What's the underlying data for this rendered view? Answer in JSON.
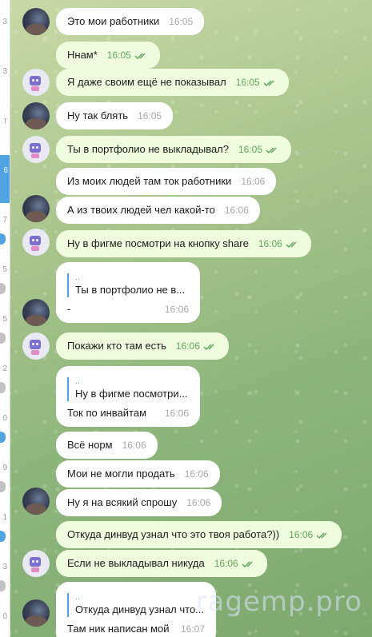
{
  "strip": {
    "texts": [
      "3",
      "3",
      "т",
      "6",
      "7",
      "5",
      "5",
      "2",
      "0",
      "9",
      "1",
      "3",
      "0"
    ],
    "selected_label": "6"
  },
  "messages": [
    {
      "text": "Это мои работники",
      "time": "16:05",
      "dir": "in"
    },
    {
      "text": "Ннам*",
      "time": "16:05",
      "dir": "out"
    },
    {
      "text": "Я даже своим ещё не показывал",
      "time": "16:05",
      "dir": "out"
    },
    {
      "text": "Ну так блять",
      "time": "16:05",
      "dir": "in"
    },
    {
      "text": "Ты в портфолио не выкладывал?",
      "time": "16:05",
      "dir": "out"
    },
    {
      "text": "Из моих людей там ток работники",
      "time": "16:06",
      "dir": "in"
    },
    {
      "text": "А из твоих людей чел какой-то",
      "time": "16:06",
      "dir": "in"
    },
    {
      "text": "Ну в фигме посмотри на кнопку share",
      "time": "16:06",
      "dir": "out"
    },
    {
      "quote_name": "..",
      "quote_text": "Ты в портфолио не в...",
      "text": "-",
      "time": "16:06",
      "dir": "in"
    },
    {
      "text": "Покажи кто там есть",
      "time": "16:06",
      "dir": "out"
    },
    {
      "quote_name": "..",
      "quote_text": "Ну в фигме посмотри...",
      "text": "Ток по инвайтам",
      "time": "16:06",
      "dir": "in"
    },
    {
      "text": "Всё норм",
      "time": "16:06",
      "dir": "in"
    },
    {
      "text": "Мои не могли продать",
      "time": "16:06",
      "dir": "in"
    },
    {
      "text": "Ну я на всякий спрошу",
      "time": "16:06",
      "dir": "in"
    },
    {
      "text": "Откуда динвуд узнал что это твоя работа?))",
      "time": "16:06",
      "dir": "out"
    },
    {
      "text": "Если не выкладывал никуда",
      "time": "16:06",
      "dir": "out"
    },
    {
      "quote_name": "..",
      "quote_text": "Откуда динвуд узнал что...",
      "text": "Там ник написан мой",
      "time": "16:07",
      "dir": "in"
    }
  ],
  "watermark": "ragemp.pro",
  "colors": {
    "incoming": "#ffffff",
    "outgoing": "#effdde",
    "accent": "#4fa3e0",
    "read_check": "#5fa560"
  }
}
